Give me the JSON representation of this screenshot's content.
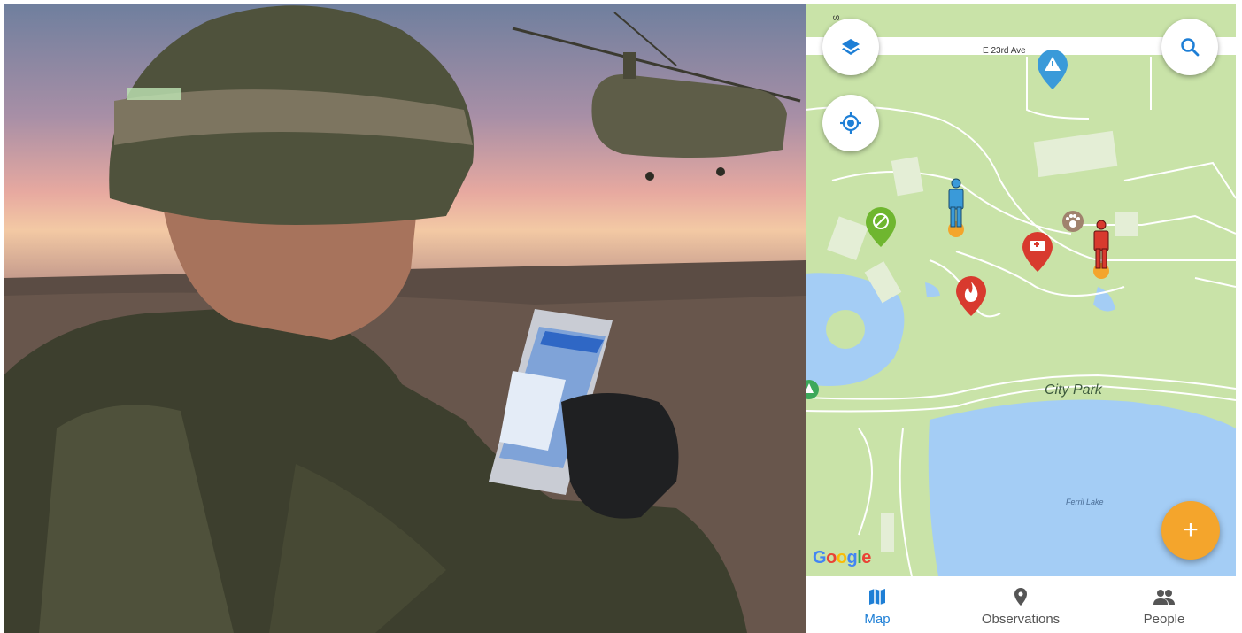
{
  "map": {
    "street_label": "E 23rd Ave",
    "street_fragment": "le S",
    "park_label": "City Park",
    "lake_label": "Ferril Lake",
    "attribution": "Google"
  },
  "controls": {
    "layers_icon": "layers-icon",
    "location_icon": "my-location-icon",
    "search_icon": "search-icon",
    "add_label": "+"
  },
  "markers": [
    {
      "icon": "warning-icon",
      "color": "#3a9ad9"
    },
    {
      "icon": "no-entry-icon",
      "color": "#6fb62f"
    },
    {
      "icon": "ambulance-icon",
      "color": "#d83a2e"
    },
    {
      "icon": "fire-icon",
      "color": "#d83a2e"
    },
    {
      "icon": "paw-icon",
      "color": "#a0826d"
    },
    {
      "icon": "person-icon",
      "color": "#3a9ad9"
    },
    {
      "icon": "person-icon",
      "color": "#d83a2e"
    }
  ],
  "nav": {
    "map_label": "Map",
    "observations_label": "Observations",
    "people_label": "People",
    "active_color": "#1e7fd6"
  },
  "colors": {
    "accent": "#1e7fd6",
    "fab": "#f4a52c",
    "park": "#c9e3a8",
    "water": "#a4cdf5"
  }
}
